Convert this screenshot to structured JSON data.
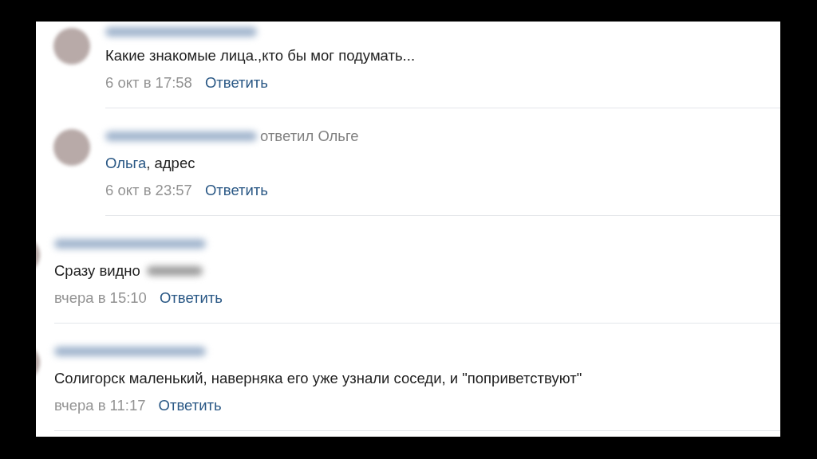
{
  "comments": [
    {
      "kind": "reply",
      "text": "Какие знакомые лица.,кто бы мог подумать...",
      "date": "6 окт в 17:58",
      "action": "Ответить"
    },
    {
      "kind": "reply",
      "header": "ответил Ольге",
      "mention": "Ольга",
      "text": ", адрес",
      "date": "6 окт в 23:57",
      "action": "Ответить"
    },
    {
      "kind": "top",
      "text": "Сразу видно",
      "hidden_word": true,
      "date": "вчера в 15:10",
      "action": "Ответить"
    },
    {
      "kind": "top",
      "text": "Солигорск маленький, наверняка его уже узнали соседи, и \"поприветствуют\"",
      "date": "вчера в 11:17",
      "action": "Ответить"
    }
  ]
}
